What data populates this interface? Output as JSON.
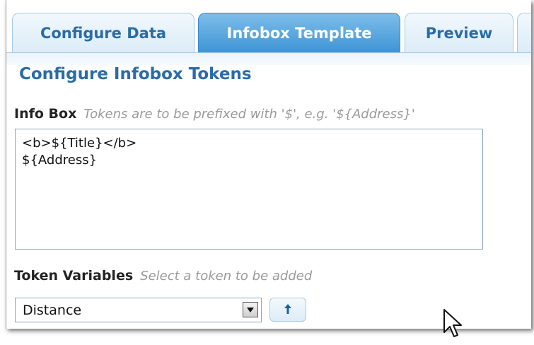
{
  "tabs": [
    {
      "label": "Configure Data",
      "active": false
    },
    {
      "label": "Infobox Template",
      "active": true
    },
    {
      "label": "Preview",
      "active": false
    }
  ],
  "section_title": "Configure Infobox Tokens",
  "infobox": {
    "label": "Info Box",
    "hint": "Tokens are to be prefixed with '$', e.g. '${Address}'",
    "lines": [
      "<b>${Title}</b>",
      "${Address}"
    ]
  },
  "tokens": {
    "label": "Token Variables",
    "hint": "Select a token to be added",
    "selected": "Distance"
  },
  "icons": {
    "dropdown": "chevron-down-icon",
    "add": "arrow-up-icon",
    "cursor": "mouse-pointer-icon"
  },
  "colors": {
    "accent": "#2a6ca8",
    "tab_active": "#3f95d6",
    "hint": "#9a9a9a"
  }
}
